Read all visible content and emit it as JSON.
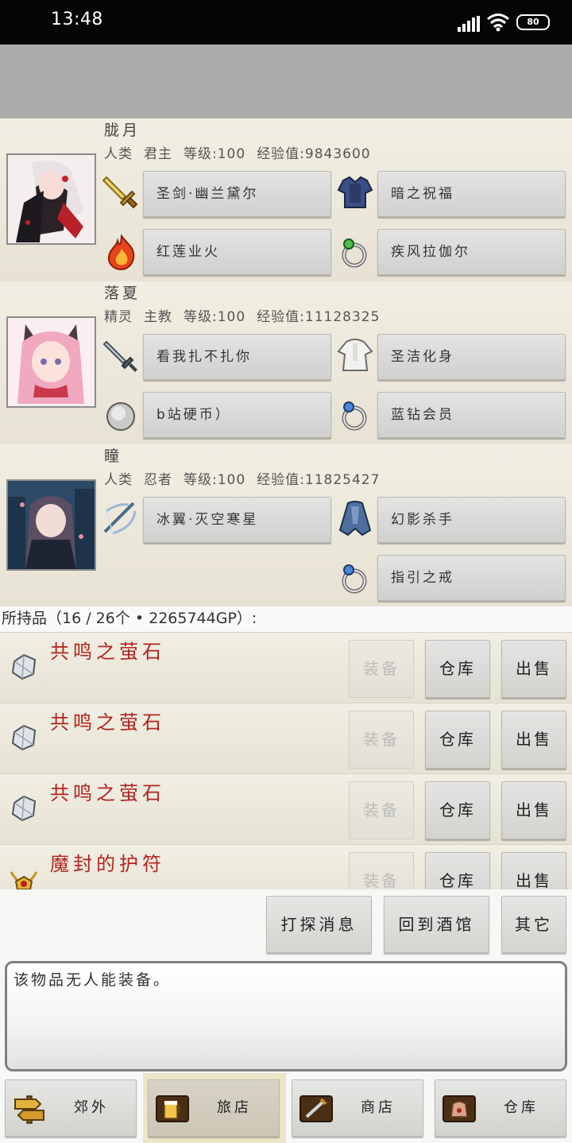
{
  "status": {
    "time": "13:48",
    "battery": "80"
  },
  "heroes": [
    {
      "name": "胧月",
      "race": "人类",
      "job": "君主",
      "level": "等级:100",
      "exp": "经验值:9843600",
      "equip": {
        "weapon": "圣剑·幽兰黛尔",
        "armor": "暗之祝福",
        "accessory1": "红莲业火",
        "accessory2": "疾风拉伽尔"
      }
    },
    {
      "name": "落夏",
      "race": "精灵",
      "job": "主教",
      "level": "等级:100",
      "exp": "经验值:11128325",
      "equip": {
        "weapon": "看我扎不扎你",
        "armor": "圣洁化身",
        "accessory1": "b站硬币）",
        "accessory2": "蓝钻会员"
      }
    },
    {
      "name": "瞳",
      "race": "人类",
      "job": "忍者",
      "level": "等级:100",
      "exp": "经验值:11825427",
      "equip": {
        "weapon": "冰翼·灭空寒星",
        "armor": "幻影杀手",
        "accessory2": "指引之戒"
      }
    }
  ],
  "inventory": {
    "header": "所持品（16 / 26个 • 2265744GP）:",
    "items": [
      {
        "name": "共鸣之萤石",
        "icon": "crystal-icon"
      },
      {
        "name": "共鸣之萤石",
        "icon": "crystal-icon"
      },
      {
        "name": "共鸣之萤石",
        "icon": "crystal-icon"
      },
      {
        "name": "魔封的护符",
        "icon": "amulet-icon"
      }
    ],
    "buttons": {
      "equip": "装备",
      "storage": "仓库",
      "sell": "出售"
    }
  },
  "actions": {
    "info": "打探消息",
    "tavern": "回到酒馆",
    "other": "其它"
  },
  "message": "该物品无人能装备。",
  "nav": {
    "outskirts": "郊外",
    "inn": "旅店",
    "shop": "商店",
    "warehouse": "仓库"
  },
  "colors": {
    "item_name": "#b5231f",
    "disabled_text": "#bcbcb8"
  }
}
